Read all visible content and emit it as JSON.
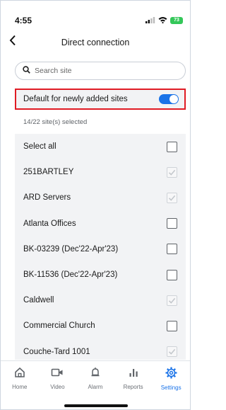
{
  "status_bar": {
    "time": "4:55",
    "battery": "73"
  },
  "header": {
    "title": "Direct connection"
  },
  "search": {
    "placeholder": "Search site"
  },
  "default_setting": {
    "label": "Default for newly added sites",
    "enabled": true
  },
  "selection": {
    "count_text": "14/22 site(s) selected"
  },
  "sites": [
    {
      "label": "Select all",
      "checked": false,
      "disabled": false
    },
    {
      "label": "251BARTLEY",
      "checked": true,
      "disabled": true
    },
    {
      "label": "ARD Servers",
      "checked": true,
      "disabled": true
    },
    {
      "label": "Atlanta Offices",
      "checked": false,
      "disabled": false
    },
    {
      "label": "BK-03239 (Dec'22-Apr'23)",
      "checked": false,
      "disabled": false
    },
    {
      "label": "BK-11536 (Dec'22-Apr'23)",
      "checked": false,
      "disabled": false
    },
    {
      "label": "Caldwell",
      "checked": true,
      "disabled": true
    },
    {
      "label": "Commercial Church",
      "checked": false,
      "disabled": false
    },
    {
      "label": "Couche-Tard 1001",
      "checked": true,
      "disabled": true
    }
  ],
  "tabs": [
    {
      "label": "Home",
      "icon": "home-icon",
      "active": false
    },
    {
      "label": "Video",
      "icon": "video-icon",
      "active": false
    },
    {
      "label": "Alarm",
      "icon": "bell-icon",
      "active": false
    },
    {
      "label": "Reports",
      "icon": "bar-chart-icon",
      "active": false
    },
    {
      "label": "Settings",
      "icon": "settings-gear-icon",
      "active": true
    }
  ],
  "colors": {
    "accent": "#1a73e8",
    "highlight_border": "#e01b24",
    "list_bg": "#f2f3f5"
  }
}
